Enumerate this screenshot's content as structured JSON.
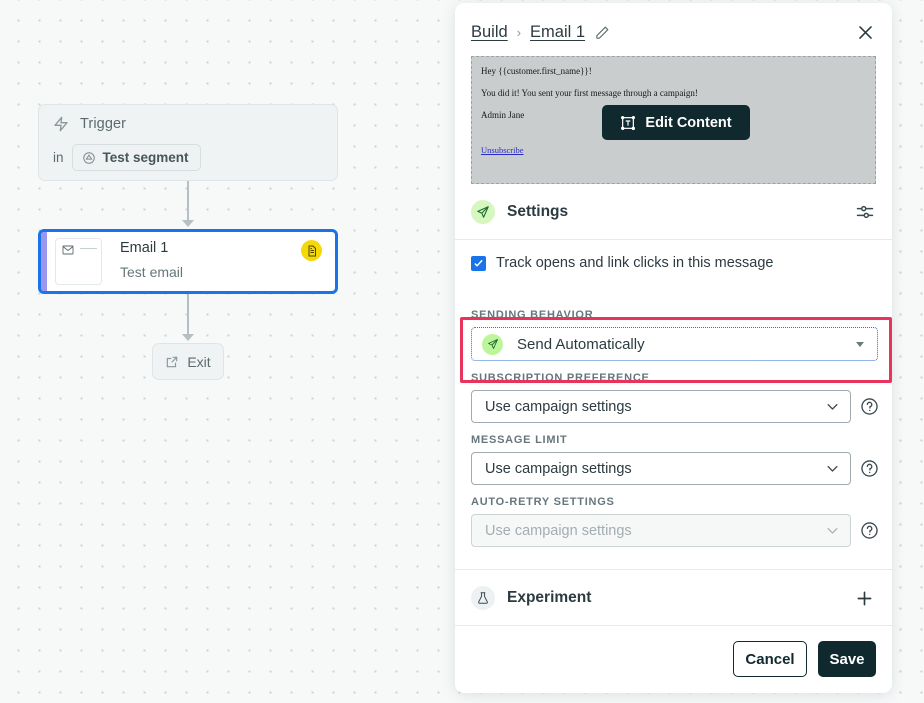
{
  "canvas": {
    "trigger_node": {
      "icon": "lightning-bolt-icon",
      "label": "Trigger",
      "in_word": "in",
      "segment_chip": {
        "icon": "segment-icon",
        "label": "Test segment"
      }
    },
    "email_node": {
      "title": "Email 1",
      "subtitle": "Test email",
      "badge_icon": "document-icon",
      "thumb_icon": "envelope-icon",
      "badge_color": "#f5d907",
      "selected_border_color": "#1a73e8",
      "accent_color": "#9b96f0"
    },
    "exit_node": {
      "icon": "exit-arrow-icon",
      "label": "Exit"
    }
  },
  "panel": {
    "breadcrumb": {
      "root": "Build",
      "separator": "›",
      "current": "Email 1",
      "edit_icon": "pencil-icon"
    },
    "close_icon": "close-icon",
    "preview": {
      "line1": "Hey {{customer.first_name}}!",
      "line2": "You did it! You sent your first message through a campaign!",
      "line3": "Admin Jane",
      "unsubscribe": "Unsubscribe",
      "edit_button": {
        "label": "Edit Content",
        "icon": "text-frame-icon"
      }
    },
    "settings": {
      "title": "Settings",
      "icon": "paper-plane-icon",
      "options_icon": "sliders-icon",
      "track_checkbox": {
        "label": "Track opens and link clicks in this message",
        "checked": true
      }
    },
    "fields": {
      "sending_behavior": {
        "label": "SENDING BEHAVIOR",
        "value": "Send Automatically",
        "icon": "paper-plane-icon",
        "highlighted": true,
        "highlight_color": "#e8335c"
      },
      "subscription_preference": {
        "label": "SUBSCRIPTION PREFERENCE",
        "value": "Use campaign settings",
        "help_icon": "question-mark-icon"
      },
      "message_limit": {
        "label": "MESSAGE LIMIT",
        "value": "Use campaign settings",
        "help_icon": "question-mark-icon"
      },
      "auto_retry_settings": {
        "label": "AUTO-RETRY SETTINGS",
        "value": "Use campaign settings",
        "help_icon": "question-mark-icon",
        "disabled": true
      }
    },
    "experiment": {
      "title": "Experiment",
      "icon": "flask-icon",
      "add_icon": "plus-icon"
    },
    "footer": {
      "cancel_label": "Cancel",
      "save_label": "Save"
    }
  }
}
